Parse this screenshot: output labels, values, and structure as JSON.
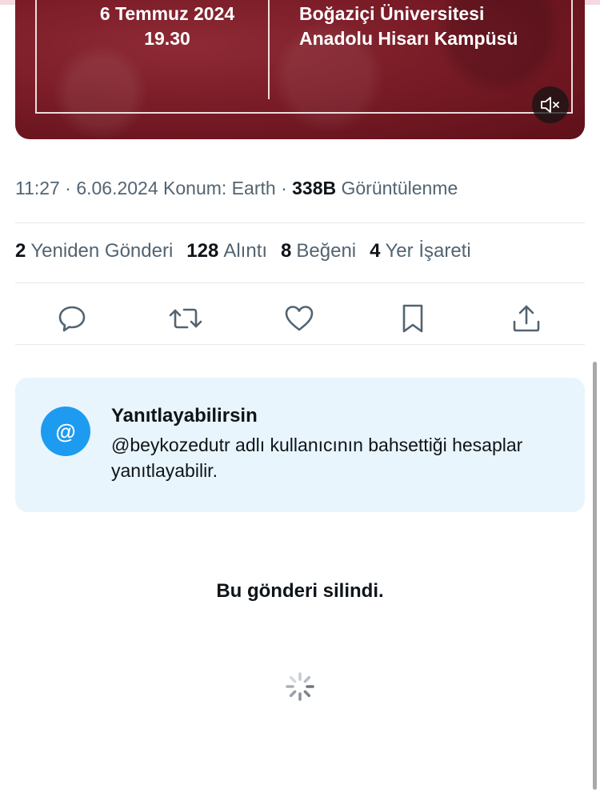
{
  "media": {
    "date": "6 Temmuz 2024",
    "time": "19.30",
    "venue_line1": "Boğaziçi Üniversitesi",
    "venue_line2": "Anadolu Hisarı Kampüsü",
    "mute_icon": "speaker-muted-icon"
  },
  "meta": {
    "time": "11:27",
    "separator": "·",
    "date": "6.06.2024",
    "location": "Konum: Earth",
    "views_count": "338B",
    "views_label": "Görüntülenme"
  },
  "stats": [
    {
      "count": "2",
      "label": "Yeniden Gönderi"
    },
    {
      "count": "128",
      "label": "Alıntı"
    },
    {
      "count": "8",
      "label": "Beğeni"
    },
    {
      "count": "4",
      "label": "Yer İşareti"
    }
  ],
  "actions": [
    "reply-icon",
    "repost-icon",
    "like-icon",
    "bookmark-icon",
    "share-icon"
  ],
  "reply_info": {
    "icon_symbol": "@",
    "title": "Yanıtlayabilirsin",
    "description": "@beykozedutr adlı kullanıcının bahsettiği hesaplar yanıtlayabilir."
  },
  "deleted_message": "Bu gönderi silindi.",
  "colors": {
    "media_bg": "#7a1c27",
    "accent": "#1d9bf0",
    "card_bg": "#e8f5fd",
    "secondary_text": "#536471"
  }
}
